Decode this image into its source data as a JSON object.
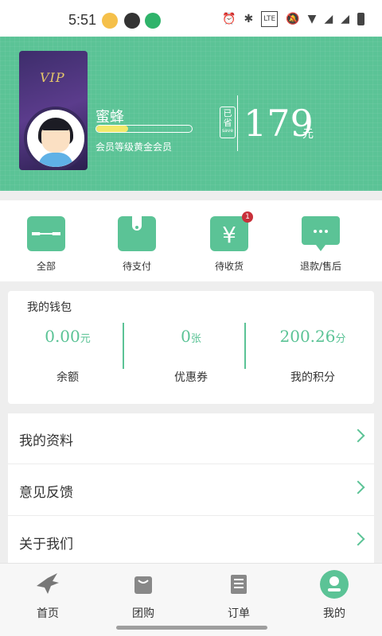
{
  "status_bar": {
    "time": "5:51"
  },
  "profile": {
    "vip_label": "VIP",
    "nickname": "蜜蜂",
    "level_progress": 0.33,
    "level_text": "会员等级黄金会员",
    "saved_label": "已省",
    "saved_sub": "save",
    "saved_amount": "179",
    "saved_unit": "元"
  },
  "orders": [
    {
      "label": "全部",
      "icon": "ticket-icon"
    },
    {
      "label": "待支付",
      "icon": "wallet-icon"
    },
    {
      "label": "待收货",
      "icon": "yen-icon",
      "badge": "1"
    },
    {
      "label": "退款/售后",
      "icon": "chat-icon"
    }
  ],
  "wallet": {
    "title": "我的钱包",
    "balance_value": "0.00",
    "balance_unit": "元",
    "balance_label": "余额",
    "coupon_value": "0",
    "coupon_unit": "张",
    "coupon_label": "优惠券",
    "points_value": "200.26",
    "points_unit": "分",
    "points_label": "我的积分"
  },
  "menu": [
    "我的资料",
    "意见反馈",
    "关于我们"
  ],
  "tabs": [
    {
      "label": "首页",
      "icon": "bird-icon"
    },
    {
      "label": "团购",
      "icon": "bag-icon"
    },
    {
      "label": "订单",
      "icon": "list-icon"
    },
    {
      "label": "我的",
      "icon": "user-icon",
      "active": true
    }
  ],
  "colors": {
    "accent": "#5bc396",
    "badge": "#c8303a",
    "progress": "#f2e96b"
  }
}
